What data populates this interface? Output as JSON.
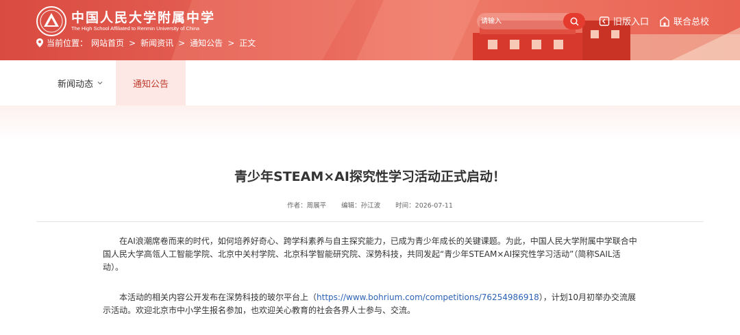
{
  "header": {
    "school_name_cn": "中国人民大学附属中学",
    "school_name_en": "The High School Affiliated to Renmin University of China",
    "search_placeholder": "请输入",
    "old_version_label": "旧版入口",
    "schools_label": "联合总校",
    "colors": {
      "banner": "#e0554a",
      "search_button": "#e53a2e"
    }
  },
  "breadcrumb": {
    "prefix": "当前位置：",
    "items": [
      "网站首页",
      "新闻资讯",
      "通知公告",
      "正文"
    ]
  },
  "nav": {
    "items": [
      {
        "label": "新闻动态",
        "has_dropdown": true,
        "active": false
      },
      {
        "label": "通知公告",
        "has_dropdown": false,
        "active": true
      }
    ],
    "colors": {
      "active_bg": "#fde8e6",
      "active_text": "#c0392b"
    }
  },
  "article": {
    "title": "青少年STEAM×AI探究性学习活动正式启动！",
    "author": "作者：周展平",
    "editor": "编辑：孙江波",
    "time": "时间：2026-07-11",
    "para1": "在AI浪潮席卷而来的时代，如何培养好奇心、跨学科素养与自主探究能力，已成为青少年成长的关键课题。为此，中国人民大学附属中学联合中国人民大学高瓴人工智能学院、北京中关村学院、北京科学智能研究院、深势科技，共同发起“青少年STEAM×AI探究性学习活动”（简称SAIL活动）。",
    "para2_before": "本活动的相关内容公开发布在深势科技的玻尔平台上（",
    "para2_link": "https://www.bohrium.com/competitions/76254986918",
    "para2_after": "），计划10月初举办交流展示活动。欢迎北京市中小学生报名参加，也欢迎关心教育的社会各界人士参与、交流。",
    "link_color": "#2c62b6"
  }
}
